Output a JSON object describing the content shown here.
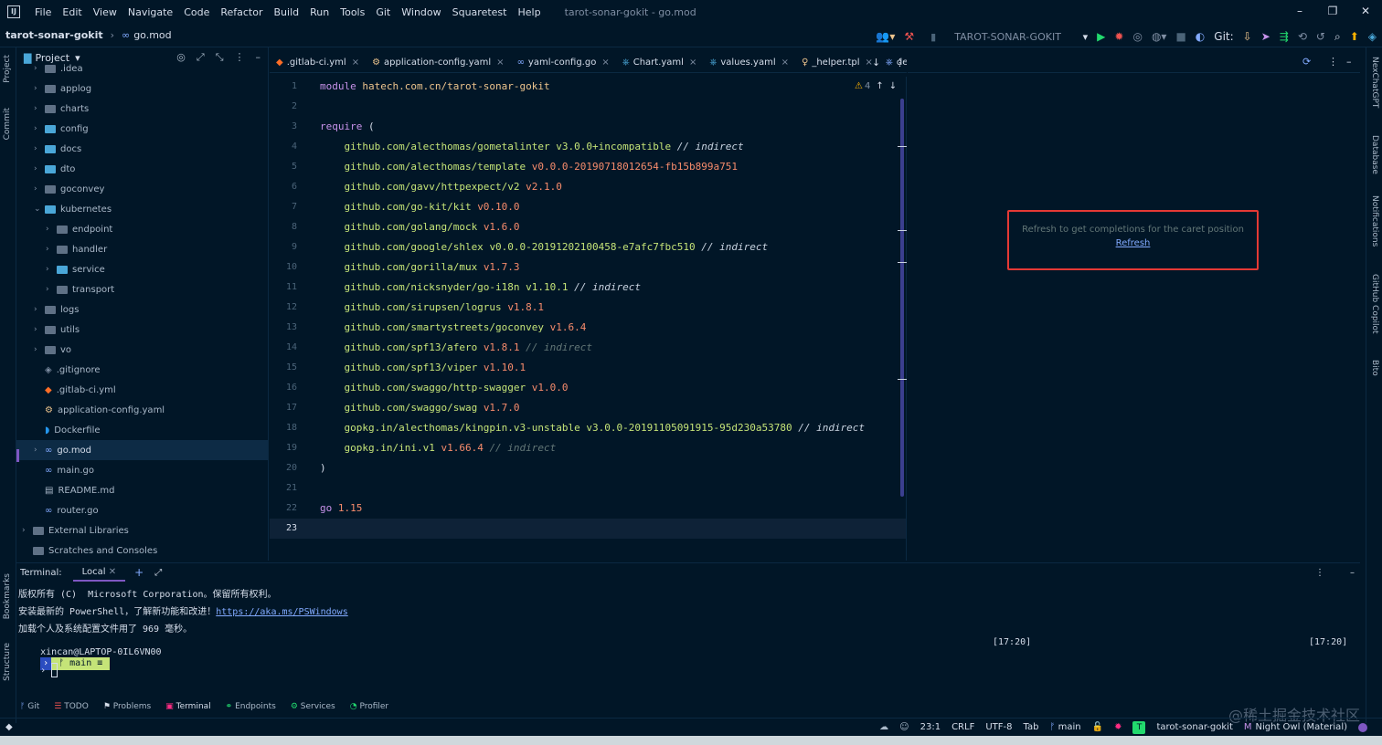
{
  "menubar": {
    "items": [
      "File",
      "Edit",
      "View",
      "Navigate",
      "Code",
      "Refactor",
      "Build",
      "Run",
      "Tools",
      "Git",
      "Window",
      "Squaretest",
      "Help"
    ],
    "window_title": "tarot-sonar-gokit - go.mod"
  },
  "navbar": {
    "project": "tarot-sonar-gokit",
    "file": "go.mod"
  },
  "toolbar": {
    "run_config": "TAROT-SONAR-GOKIT",
    "git_label": "Git:"
  },
  "left_strip": {
    "project": "Project",
    "commit": "Commit",
    "bookmarks": "Bookmarks",
    "structure": "Structure"
  },
  "right_strip": {
    "nexchat": "NexChatGPT",
    "database": "Database",
    "notifications": "Notifications",
    "copilot": "GitHub Copilot",
    "bito": "Bito"
  },
  "project_panel": {
    "title": "Project",
    "items": [
      {
        "label": ".idea",
        "depth": 1,
        "kind": "folder",
        "chev": true
      },
      {
        "label": "applog",
        "depth": 1,
        "kind": "folder",
        "chev": true
      },
      {
        "label": "charts",
        "depth": 1,
        "kind": "folder",
        "chev": true
      },
      {
        "label": "config",
        "depth": 1,
        "kind": "folder-b",
        "chev": true
      },
      {
        "label": "docs",
        "depth": 1,
        "kind": "folder-b",
        "chev": true
      },
      {
        "label": "dto",
        "depth": 1,
        "kind": "folder-b",
        "chev": true
      },
      {
        "label": "goconvey",
        "depth": 1,
        "kind": "folder",
        "chev": true
      },
      {
        "label": "kubernetes",
        "depth": 1,
        "kind": "folder-b",
        "chev": true,
        "open": true
      },
      {
        "label": "endpoint",
        "depth": 2,
        "kind": "folder",
        "chev": true
      },
      {
        "label": "handler",
        "depth": 2,
        "kind": "folder",
        "chev": true
      },
      {
        "label": "service",
        "depth": 2,
        "kind": "folder-b",
        "chev": true
      },
      {
        "label": "transport",
        "depth": 2,
        "kind": "folder",
        "chev": true
      },
      {
        "label": "logs",
        "depth": 1,
        "kind": "folder",
        "chev": true
      },
      {
        "label": "utils",
        "depth": 1,
        "kind": "folder",
        "chev": true
      },
      {
        "label": "vo",
        "depth": 1,
        "kind": "folder",
        "chev": true
      },
      {
        "label": ".gitignore",
        "depth": 1,
        "kind": "file",
        "icon": "◈",
        "color": "#7f8ea3"
      },
      {
        "label": ".gitlab-ci.yml",
        "depth": 1,
        "kind": "file",
        "icon": "◆",
        "color": "#fc6d26"
      },
      {
        "label": "application-config.yaml",
        "depth": 1,
        "kind": "file",
        "icon": "⚙",
        "color": "#ecc48d"
      },
      {
        "label": "Dockerfile",
        "depth": 1,
        "kind": "file",
        "icon": "◗",
        "color": "#2496ed"
      },
      {
        "label": "go.mod",
        "depth": 1,
        "kind": "file",
        "icon": "∞",
        "color": "#82aaff",
        "chev": true,
        "selected": true
      },
      {
        "label": "main.go",
        "depth": 1,
        "kind": "file",
        "icon": "∞",
        "color": "#82aaff"
      },
      {
        "label": "README.md",
        "depth": 1,
        "kind": "file",
        "icon": "▤",
        "color": "#a9b8c8"
      },
      {
        "label": "router.go",
        "depth": 1,
        "kind": "file",
        "icon": "∞",
        "color": "#82aaff"
      },
      {
        "label": "External Libraries",
        "depth": 0,
        "kind": "folder",
        "chev": true
      },
      {
        "label": "Scratches and Consoles",
        "depth": 0,
        "kind": "folder"
      }
    ]
  },
  "tabs": [
    {
      "label": ".gitlab-ci.yml",
      "icon": "◆",
      "color": "#fc6d26"
    },
    {
      "label": "application-config.yaml",
      "icon": "⚙",
      "color": "#ecc48d"
    },
    {
      "label": "yaml-config.go",
      "icon": "∞",
      "color": "#82aaff"
    },
    {
      "label": "Chart.yaml",
      "icon": "⎈",
      "color": "#4aa7d8"
    },
    {
      "label": "values.yaml",
      "icon": "⎈",
      "color": "#4aa7d8"
    },
    {
      "label": "_helper.tpl",
      "icon": "♀",
      "color": "#ecc48d"
    },
    {
      "label": "dep",
      "icon": "⎈",
      "color": "#82aaff"
    }
  ],
  "editor": {
    "warning_count": "4",
    "current_line": 23,
    "lines": [
      [
        {
          "t": "module ",
          "c": "kw"
        },
        {
          "t": "hatech.com.cn/tarot-sonar-gokit",
          "c": "str"
        }
      ],
      [],
      [
        {
          "t": "require ",
          "c": "kw"
        },
        {
          "t": "(",
          "c": ""
        }
      ],
      [
        {
          "t": "    github.com/alecthomas/gometalinter ",
          "c": "pkg"
        },
        {
          "t": "v3.0.0+incompatible ",
          "c": "pkg"
        },
        {
          "t": "// indirect",
          "c": "cm-strong"
        }
      ],
      [
        {
          "t": "    github.com/alecthomas/template ",
          "c": "pkg"
        },
        {
          "t": "v0.0.0-20190718012654-fb15b899a751",
          "c": "ver"
        }
      ],
      [
        {
          "t": "    github.com/gavv/httpexpect/v2 ",
          "c": "pkg"
        },
        {
          "t": "v2.1.0",
          "c": "ver"
        }
      ],
      [
        {
          "t": "    github.com/go-kit/kit ",
          "c": "pkg"
        },
        {
          "t": "v0.10.0",
          "c": "ver"
        }
      ],
      [
        {
          "t": "    github.com/golang/mock ",
          "c": "pkg"
        },
        {
          "t": "v1.6.0",
          "c": "ver"
        }
      ],
      [
        {
          "t": "    github.com/google/shlex ",
          "c": "pkg"
        },
        {
          "t": "v0.0.0-20191202100458-e7afc7fbc510 ",
          "c": "pkg"
        },
        {
          "t": "// indirect",
          "c": "cm-strong"
        }
      ],
      [
        {
          "t": "    github.com/gorilla/mux ",
          "c": "pkg"
        },
        {
          "t": "v1.7.3",
          "c": "ver"
        }
      ],
      [
        {
          "t": "    github.com/nicksnyder/go-i18n ",
          "c": "pkg"
        },
        {
          "t": "v1.10.1 ",
          "c": "pkg"
        },
        {
          "t": "// indirect",
          "c": "cm-strong"
        }
      ],
      [
        {
          "t": "    github.com/sirupsen/logrus ",
          "c": "pkg"
        },
        {
          "t": "v1.8.1",
          "c": "ver"
        }
      ],
      [
        {
          "t": "    github.com/smartystreets/goconvey ",
          "c": "pkg"
        },
        {
          "t": "v1.6.4",
          "c": "ver"
        }
      ],
      [
        {
          "t": "    github.com/spf13/afero ",
          "c": "pkg"
        },
        {
          "t": "v1.8.1 ",
          "c": "ver"
        },
        {
          "t": "// indirect",
          "c": "cm"
        }
      ],
      [
        {
          "t": "    github.com/spf13/viper ",
          "c": "pkg"
        },
        {
          "t": "v1.10.1",
          "c": "ver"
        }
      ],
      [
        {
          "t": "    github.com/swaggo/http-swagger ",
          "c": "pkg"
        },
        {
          "t": "v1.0.0",
          "c": "ver"
        }
      ],
      [
        {
          "t": "    github.com/swaggo/swag ",
          "c": "pkg"
        },
        {
          "t": "v1.7.0",
          "c": "ver"
        }
      ],
      [
        {
          "t": "    gopkg.in/alecthomas/kingpin.v3-unstable ",
          "c": "pkg"
        },
        {
          "t": "v3.0.0-20191105091915-95d230a53780 ",
          "c": "pkg"
        },
        {
          "t": "// indirect",
          "c": "cm-strong"
        }
      ],
      [
        {
          "t": "    gopkg.in/ini.v1 ",
          "c": "pkg"
        },
        {
          "t": "v1.66.4 ",
          "c": "ver"
        },
        {
          "t": "// indirect",
          "c": "cm"
        }
      ],
      [
        {
          "t": ")",
          "c": ""
        }
      ],
      [],
      [
        {
          "t": "go ",
          "c": "kw"
        },
        {
          "t": "1.15",
          "c": "ver"
        }
      ],
      []
    ]
  },
  "completion": {
    "message": "Refresh to get completions for the caret position",
    "link": "Refresh"
  },
  "terminal": {
    "title": "Terminal:",
    "tab": "Local",
    "lines": [
      "版权所有 (C)  Microsoft Corporation。保留所有权利。",
      "安装最新的 PowerShell，了解新功能和改进！"
    ],
    "link": "https://aka.ms/PSWindows",
    "line3": "加载个人及系统配置文件用了 969 毫秒。",
    "prompt_user": "xincan@LAPTOP-0IL6VN00",
    "prompt_branch": "ᚠ main ≡",
    "time_left": "[17:20]",
    "time_right": "[17:20]",
    "cursor_prompt": "›"
  },
  "bottom_tabs": [
    "Git",
    "TODO",
    "Problems",
    "Terminal",
    "Endpoints",
    "Services",
    "Profiler"
  ],
  "status": {
    "position": "23:1",
    "line_sep": "CRLF",
    "encoding": "UTF-8",
    "indent": "Tab",
    "branch": "main",
    "project": "tarot-sonar-gokit",
    "theme": "Night Owl (Material)"
  },
  "watermark": "@稀土掘金技术社区"
}
